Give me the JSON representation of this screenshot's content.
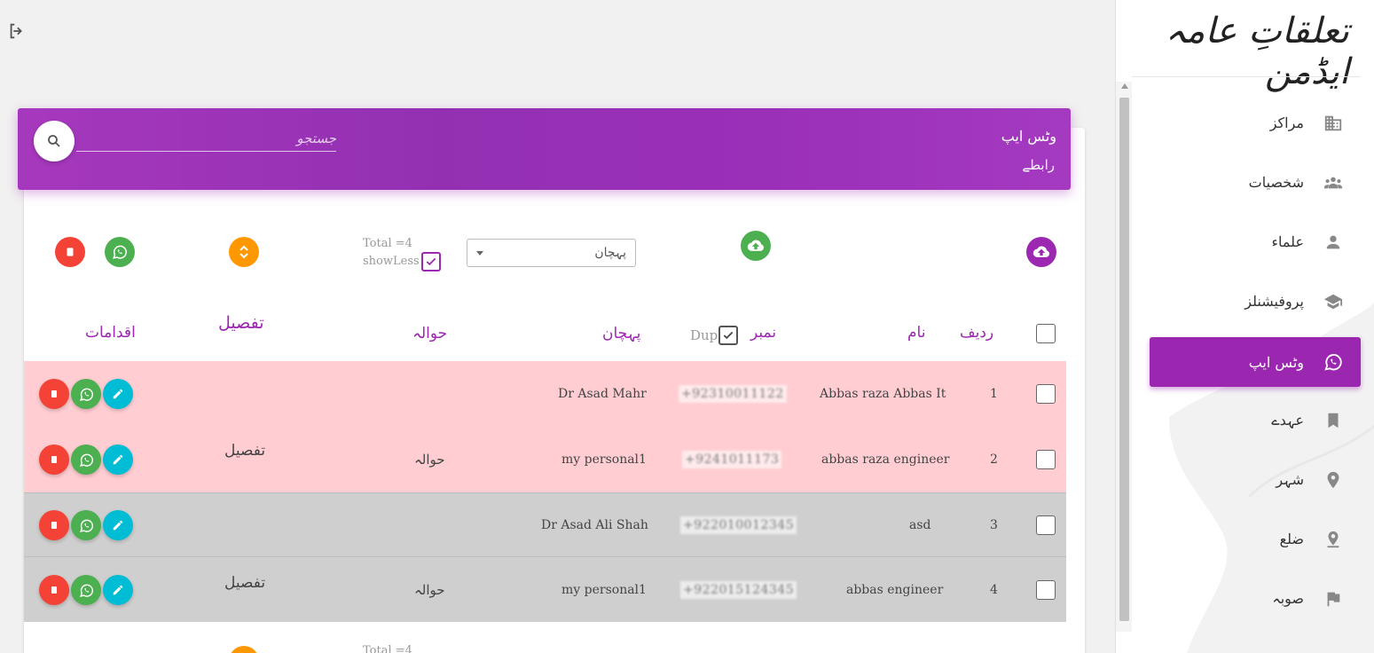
{
  "brand": "تعلقاتِ عامہ ایڈمن",
  "header": {
    "title": "وٹس ایپ",
    "subtitle": "رابطے",
    "search_placeholder": "جستجو"
  },
  "toolbar": {
    "total_label": "Total =4",
    "show_less_label": "showLess",
    "select_value": "پہچان"
  },
  "table": {
    "headers": {
      "row_no": "ردیف",
      "name": "نام",
      "number": "نمبر",
      "dup": "Dup",
      "identity": "پہچان",
      "reference": "حوالہ",
      "details": "تفصیل",
      "actions": "اقدامات"
    },
    "rows": [
      {
        "no": "1",
        "name": "Abbas raza Abbas It",
        "number": "+92310011122",
        "identity": "Dr Asad Mahr",
        "reference": "",
        "details": ""
      },
      {
        "no": "2",
        "name": "abbas raza engineer",
        "number": "+9241011173",
        "identity": "my personal1",
        "reference": "حوالہ",
        "details": "تفصیل"
      },
      {
        "no": "3",
        "name": "asd",
        "number": "+922010012345",
        "identity": "Dr Asad Ali Shah",
        "reference": "",
        "details": ""
      },
      {
        "no": "4",
        "name": "abbas engineer",
        "number": "+922015124345",
        "identity": "my personal1",
        "reference": "حوالہ",
        "details": "تفصیل"
      }
    ]
  },
  "footer": {
    "total_label": "Total =4"
  },
  "sidebar": {
    "items": [
      {
        "label": "مراکز",
        "icon": "building-icon"
      },
      {
        "label": "شخصیات",
        "icon": "people-icon"
      },
      {
        "label": "علماء",
        "icon": "person-icon"
      },
      {
        "label": "پروفیشنلز",
        "icon": "graduation-cap-icon"
      },
      {
        "label": "وٹس ایپ",
        "icon": "whatsapp-icon",
        "active": true
      },
      {
        "label": "عہدے",
        "icon": "bookmark-icon"
      },
      {
        "label": "شہر",
        "icon": "location-pin-icon"
      },
      {
        "label": "ضلع",
        "icon": "location-pin-outline-icon"
      },
      {
        "label": "صوبہ",
        "icon": "flag-icon"
      }
    ]
  },
  "colors": {
    "accent": "#9c27b0",
    "red": "#f44336",
    "green": "#4caf50",
    "orange": "#ff9800",
    "cyan": "#00bcd4",
    "row_pink": "#ffcdd2",
    "row_grey": "#cfcfcf"
  }
}
